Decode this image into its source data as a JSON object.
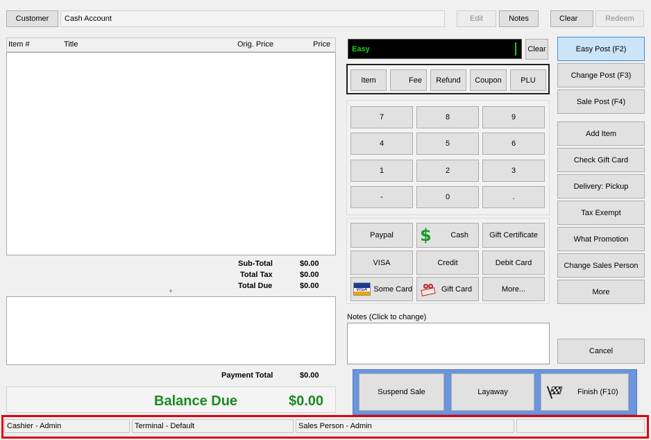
{
  "customer": {
    "button_label": "Customer",
    "account_value": "Cash Account",
    "edit_label": "Edit",
    "notes_label": "Notes",
    "clear_label": "Clear",
    "redeem_label": "Redeem"
  },
  "items_table": {
    "col_item": "Item #",
    "col_title": "Title",
    "col_orig_price": "Orig. Price",
    "col_price": "Price"
  },
  "totals": {
    "subtotal_label": "Sub-Total",
    "subtotal_value": "$0.00",
    "tax_label": "Total Tax",
    "tax_value": "$0.00",
    "due_label": "Total Due",
    "due_value": "$0.00",
    "dot": "°",
    "payment_total_label": "Payment Total",
    "payment_total_value": "$0.00",
    "balance_due_label": "Balance Due",
    "balance_due_value": "$0.00"
  },
  "entry": {
    "mode_text": "Easy",
    "clear_label": "Clear"
  },
  "entry_types": [
    "Item",
    "Fee",
    "Refund",
    "Coupon",
    "PLU"
  ],
  "keypad": [
    "7",
    "8",
    "9",
    "4",
    "5",
    "6",
    "1",
    "2",
    "3",
    "-",
    "0",
    "."
  ],
  "payments": {
    "paypal": "Paypal",
    "cash": "Cash",
    "gift_certificate": "Gift Certificate",
    "visa": "VISA",
    "credit": "Credit",
    "debit_card": "Debit Card",
    "some_card": "Some Card",
    "gift_card": "Gift Card",
    "more": "More..."
  },
  "notes": {
    "label": "Notes (Click to change)"
  },
  "actions": {
    "easy_post": "Easy Post (F2)",
    "change_post": "Change Post (F3)",
    "sale_post": "Sale Post (F4)",
    "add_item": "Add Item",
    "check_gift_card": "Check Gift Card",
    "delivery": "Delivery: Pickup",
    "tax_exempt": "Tax Exempt",
    "what_promotion": "What Promotion",
    "change_sales_person": "Change Sales Person",
    "more": "More",
    "cancel": "Cancel"
  },
  "bottom_actions": {
    "suspend": "Suspend Sale",
    "layaway": "Layaway",
    "finish": "Finish (F10)"
  },
  "status_bar": {
    "cashier": "Cashier - Admin",
    "terminal": "Terminal - Default",
    "sales_person": "Sales Person - Admin",
    "extra": ""
  },
  "colors": {
    "highlight_border": "#e0000e",
    "balance_green": "#1b8a22",
    "bottom_panel_blue": "#6b95dc",
    "selected_blue": "#cce4f7"
  }
}
